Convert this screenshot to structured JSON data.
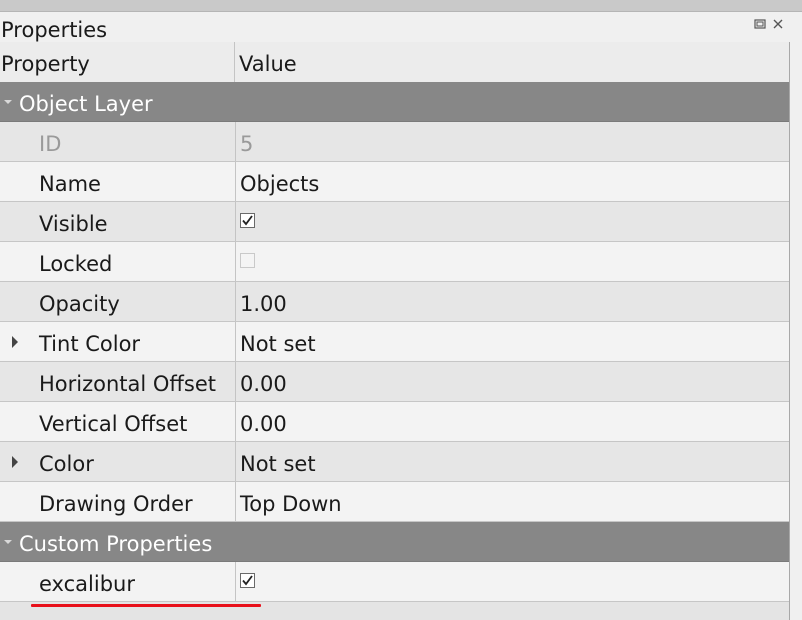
{
  "panel": {
    "title": "Properties"
  },
  "titlebar_buttons": [
    {
      "name": "float-button",
      "icon": "float-icon"
    },
    {
      "name": "close-button",
      "icon": "close-icon"
    }
  ],
  "header": {
    "property": "Property",
    "value": "Value"
  },
  "groups": {
    "object_layer": "Object Layer",
    "custom_properties": "Custom Properties"
  },
  "rows": {
    "id": {
      "label": "ID",
      "value": "5"
    },
    "name": {
      "label": "Name",
      "value": "Objects"
    },
    "visible": {
      "label": "Visible",
      "checked": true
    },
    "locked": {
      "label": "Locked",
      "checked": false
    },
    "opacity": {
      "label": "Opacity",
      "value": "1.00"
    },
    "tint_color": {
      "label": "Tint Color",
      "value": "Not set"
    },
    "horizontal_offset": {
      "label": "Horizontal Offset",
      "value": "0.00"
    },
    "vertical_offset": {
      "label": "Vertical Offset",
      "value": "0.00"
    },
    "color": {
      "label": "Color",
      "value": "Not set"
    },
    "drawing_order": {
      "label": "Drawing Order",
      "value": "Top Down"
    },
    "excalibur": {
      "label": "excalibur",
      "checked": true
    }
  },
  "colors": {
    "group_header": "#878787",
    "annotation_underline": "#e8101a"
  }
}
